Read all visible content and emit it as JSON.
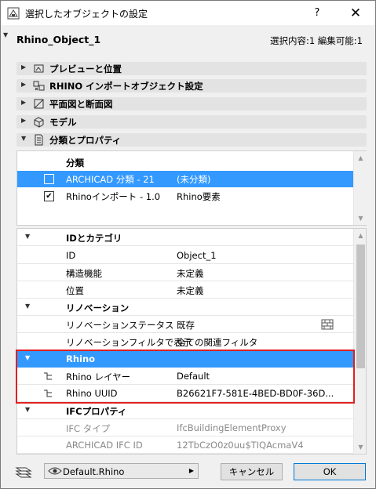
{
  "window": {
    "title": "選択したオブジェクトの設定",
    "help": "?",
    "close": "✕"
  },
  "header": {
    "object_name": "Rhino_Object_1",
    "selection_info": "選択内容:1 編集可能:1"
  },
  "sections": [
    {
      "label": "プレビューと位置",
      "icon": "preview-icon",
      "expanded": false
    },
    {
      "label": "RHINO インポートオブジェクト設定",
      "icon": "rhino-import-icon",
      "expanded": false
    },
    {
      "label": "平面図と断面図",
      "icon": "floorplan-icon",
      "expanded": false
    },
    {
      "label": "モデル",
      "icon": "model-cube-icon",
      "expanded": false
    },
    {
      "label": "分類とプロパティ",
      "icon": "document-icon",
      "expanded": true
    }
  ],
  "classification": {
    "header": "分類",
    "rows": [
      {
        "system": "ARCHICAD 分類 - 21",
        "value": "(未分類)",
        "checked": false,
        "selected": true
      },
      {
        "system": "Rhinoインポート - 1.0",
        "value": "Rhino要素",
        "checked": true,
        "selected": false
      }
    ]
  },
  "properties": {
    "groups": [
      {
        "name": "IDとカテゴリ",
        "rows": [
          {
            "key": "ID",
            "value": "Object_1"
          },
          {
            "key": "構造機能",
            "value": "未定義"
          },
          {
            "key": "位置",
            "value": "未定義"
          }
        ]
      },
      {
        "name": "リノベーション",
        "rows": [
          {
            "key": "リノベーションステータス",
            "value": "既存"
          },
          {
            "key": "リノベーションフィルタで表示",
            "value": "全ての関連フィルタ"
          }
        ]
      },
      {
        "name": "Rhino",
        "rows": [
          {
            "key": "Rhino レイヤー",
            "value": "Default"
          },
          {
            "key": "Rhino UUID",
            "value": "B26621F7-581E-4BED-BD0F-36D..."
          }
        ]
      },
      {
        "name": "IFCプロパティ",
        "rows": [
          {
            "key": "IFC タイプ",
            "value": "IfcBuildingElementProxy"
          },
          {
            "key": "ARCHICAD IFC ID",
            "value": "12TbCzO0z0uu$TIQAcmaV4"
          }
        ]
      }
    ]
  },
  "footer": {
    "view_setting": "Default.Rhino",
    "cancel": "キャンセル",
    "ok": "OK"
  },
  "colors": {
    "selection": "#3399ff",
    "highlight_box": "#e02020"
  }
}
